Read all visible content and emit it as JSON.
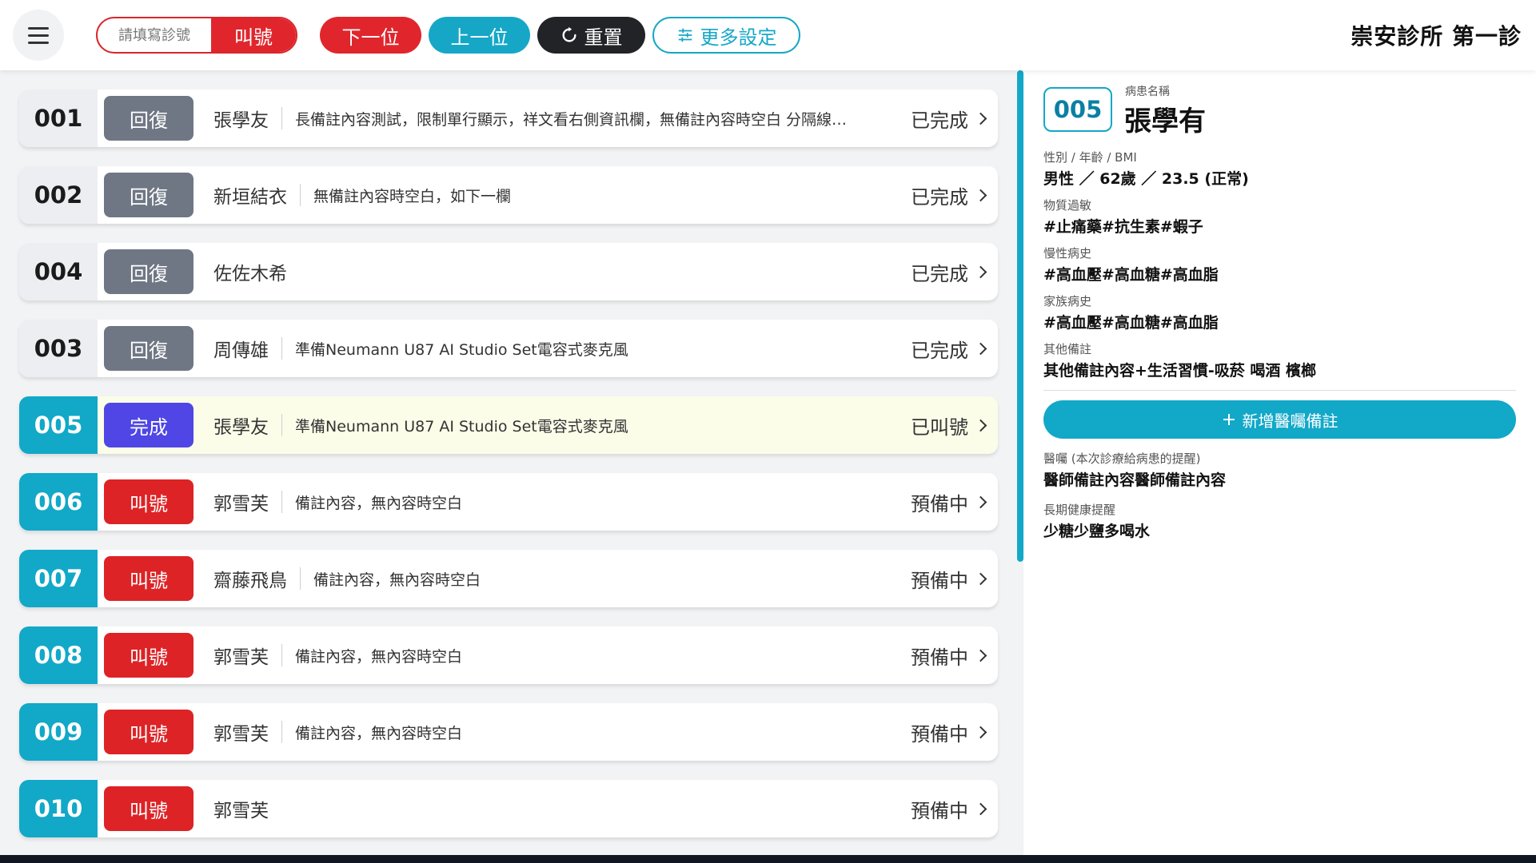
{
  "header": {
    "call_placeholder": "請填寫診號",
    "call_label": "叫號",
    "next_label": "下一位",
    "prev_label": "上一位",
    "reset_label": "重置",
    "more_label": "更多設定",
    "clinic_title": "崇安診所 第一診"
  },
  "queue": [
    {
      "number": "001",
      "action": "回復",
      "name": "張學友",
      "note": "長備註內容測試，限制單行顯示，祥文看右側資訊欄，無備註內容時空白 分隔線…",
      "status": "已完成"
    },
    {
      "number": "002",
      "action": "回復",
      "name": "新垣結衣",
      "note": "無備註內容時空白，如下一欄",
      "status": "已完成"
    },
    {
      "number": "004",
      "action": "回復",
      "name": "佐佐木希",
      "note": "",
      "status": "已完成"
    },
    {
      "number": "003",
      "action": "回復",
      "name": "周傳雄",
      "note": "準備Neumann U87 AI Studio Set電容式麥克風",
      "status": "已完成"
    },
    {
      "number": "005",
      "action": "完成",
      "name": "張學友",
      "note": "準備Neumann U87 AI Studio Set電容式麥克風",
      "status": "已叫號"
    },
    {
      "number": "006",
      "action": "叫號",
      "name": "郭雪芙",
      "note": "備註內容，無內容時空白",
      "status": "預備中"
    },
    {
      "number": "007",
      "action": "叫號",
      "name": "齋藤飛鳥",
      "note": "備註內容，無內容時空白",
      "status": "預備中"
    },
    {
      "number": "008",
      "action": "叫號",
      "name": "郭雪芙",
      "note": "備註內容，無內容時空白",
      "status": "預備中"
    },
    {
      "number": "009",
      "action": "叫號",
      "name": "郭雪芙",
      "note": "備註內容，無內容時空白",
      "status": "預備中"
    },
    {
      "number": "010",
      "action": "叫號",
      "name": "郭雪芙",
      "note": "",
      "status": "預備中"
    }
  ],
  "patient": {
    "id": "005",
    "name_label": "病患名稱",
    "name": "張學有",
    "basic_label": "性別 / 年齡 / BMI",
    "basic_value": "男性 ／ 62歲 ／ 23.5 (正常)",
    "allergy_label": "物質過敏",
    "allergy_value": "#止痛藥#抗生素#蝦子",
    "chronic_label": "慢性病史",
    "chronic_value": "#高血壓#高血糖#高血脂",
    "family_label": "家族病史",
    "family_value": "#高血壓#高血糖#高血脂",
    "other_label": "其他備註",
    "other_value": "其他備註內容+生活習慣-吸菸 喝酒 檳榔",
    "add_note_label": "新增醫囑備註",
    "advice_label": "醫囑 (本次診療給病患的提醒)",
    "advice_value": "醫師備註內容醫師備註內容",
    "longterm_label": "長期健康提醒",
    "longterm_value": "少糖少鹽多喝水"
  },
  "colors": {
    "accent": "#12a8c8",
    "danger": "#e0262c",
    "complete": "#4f46e5",
    "reply": "#6f7784",
    "current_row": "#fbfde9"
  }
}
